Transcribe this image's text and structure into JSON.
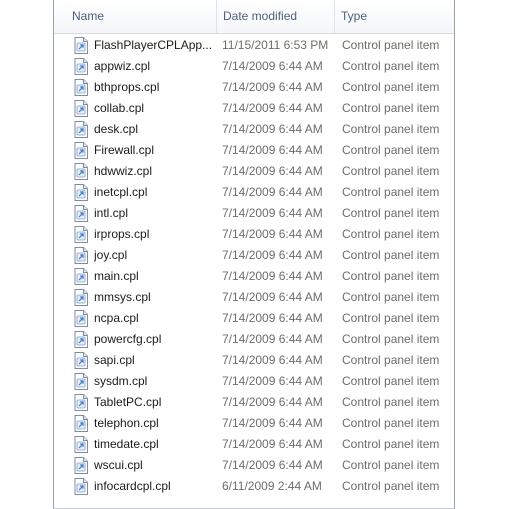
{
  "header": {
    "name_label": "Name",
    "date_label": "Date modified",
    "type_label": "Type"
  },
  "files": [
    {
      "name": "FlashPlayerCPLApp...",
      "date": "11/15/2011 6:53 PM",
      "type": "Control panel item"
    },
    {
      "name": "appwiz.cpl",
      "date": "7/14/2009 6:44 AM",
      "type": "Control panel item"
    },
    {
      "name": "bthprops.cpl",
      "date": "7/14/2009 6:44 AM",
      "type": "Control panel item"
    },
    {
      "name": "collab.cpl",
      "date": "7/14/2009 6:44 AM",
      "type": "Control panel item"
    },
    {
      "name": "desk.cpl",
      "date": "7/14/2009 6:44 AM",
      "type": "Control panel item"
    },
    {
      "name": "Firewall.cpl",
      "date": "7/14/2009 6:44 AM",
      "type": "Control panel item"
    },
    {
      "name": "hdwwiz.cpl",
      "date": "7/14/2009 6:44 AM",
      "type": "Control panel item"
    },
    {
      "name": "inetcpl.cpl",
      "date": "7/14/2009 6:44 AM",
      "type": "Control panel item"
    },
    {
      "name": "intl.cpl",
      "date": "7/14/2009 6:44 AM",
      "type": "Control panel item"
    },
    {
      "name": "irprops.cpl",
      "date": "7/14/2009 6:44 AM",
      "type": "Control panel item"
    },
    {
      "name": "joy.cpl",
      "date": "7/14/2009 6:44 AM",
      "type": "Control panel item"
    },
    {
      "name": "main.cpl",
      "date": "7/14/2009 6:44 AM",
      "type": "Control panel item"
    },
    {
      "name": "mmsys.cpl",
      "date": "7/14/2009 6:44 AM",
      "type": "Control panel item"
    },
    {
      "name": "ncpa.cpl",
      "date": "7/14/2009 6:44 AM",
      "type": "Control panel item"
    },
    {
      "name": "powercfg.cpl",
      "date": "7/14/2009 6:44 AM",
      "type": "Control panel item"
    },
    {
      "name": "sapi.cpl",
      "date": "7/14/2009 6:44 AM",
      "type": "Control panel item"
    },
    {
      "name": "sysdm.cpl",
      "date": "7/14/2009 6:44 AM",
      "type": "Control panel item"
    },
    {
      "name": "TabletPC.cpl",
      "date": "7/14/2009 6:44 AM",
      "type": "Control panel item"
    },
    {
      "name": "telephon.cpl",
      "date": "7/14/2009 6:44 AM",
      "type": "Control panel item"
    },
    {
      "name": "timedate.cpl",
      "date": "7/14/2009 6:44 AM",
      "type": "Control panel item"
    },
    {
      "name": "wscui.cpl",
      "date": "7/14/2009 6:44 AM",
      "type": "Control panel item"
    },
    {
      "name": "infocardcpl.cpl",
      "date": "6/11/2009 2:44 AM",
      "type": "Control panel item"
    }
  ],
  "icon": "control-panel-file-icon"
}
